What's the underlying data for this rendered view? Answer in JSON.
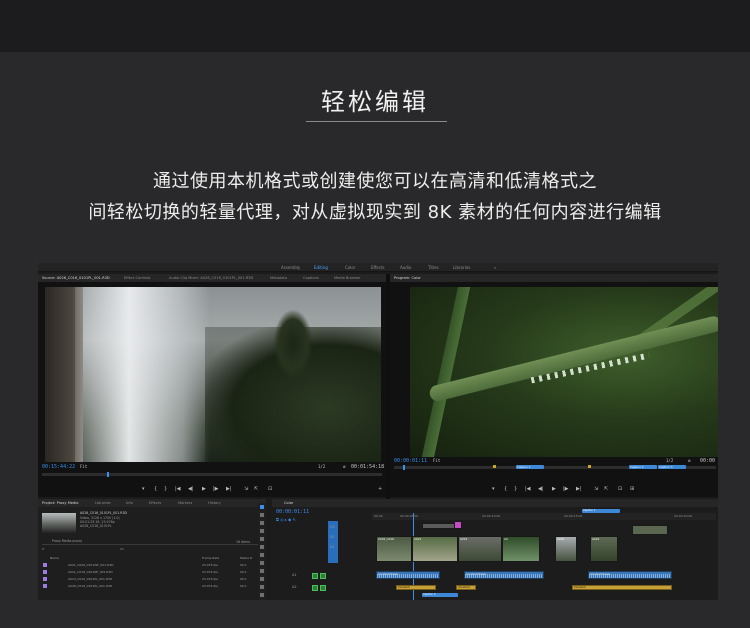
{
  "page": {
    "title": "轻松编辑",
    "desc_line1": "通过使用本机格式或创建使您可以在高清和低清格式之",
    "desc_line2": "间轻松切换的轻量代理，对从虚拟现实到 8K 素材的任何内容进行编辑"
  },
  "workspaces": [
    {
      "label": "Assembly",
      "active": false
    },
    {
      "label": "Editing",
      "active": true
    },
    {
      "label": "Color",
      "active": false
    },
    {
      "label": "Effects",
      "active": false
    },
    {
      "label": "Audio",
      "active": false
    },
    {
      "label": "Titles",
      "active": false
    },
    {
      "label": "Libraries",
      "active": false
    }
  ],
  "source_panel": {
    "tabs": [
      "Source: A026_C016_0101PL_001.R3D",
      "Effect Controls",
      "Audio Clip Mixer: A026_C016_0101PL_001.R3D",
      "Metadata",
      "Captions",
      "Media Browser"
    ],
    "timecode_in": "00:15:44:22",
    "fit": "Fit",
    "zoom": "1/2",
    "timecode_out": "00:01:54:18"
  },
  "program_panel": {
    "tab": "Program: Color",
    "timecode_in": "00:00:01:11",
    "fit": "Fit",
    "zoom": "1/2",
    "timecode_out": "00:00",
    "markers": [
      "Caption 1",
      "Caption 2",
      "Caption 3"
    ]
  },
  "transport": {
    "source_buttons": [
      "▾",
      "{",
      "}",
      "|◀",
      "◀|",
      "▶",
      "|▶",
      "▶|",
      "⇲",
      "⇱",
      "⊡",
      "+"
    ],
    "program_buttons": [
      "▾",
      "{",
      "}",
      "|◀",
      "◀|",
      "▶",
      "|▶",
      "▶|",
      "⇲",
      "⇱",
      "⊡",
      "⊞"
    ]
  },
  "project_panel": {
    "tabs": [
      "Project: Proxy Media",
      "Libraries",
      "Info",
      "Effects",
      "Markers",
      "History"
    ],
    "clip_name": "A026_C016_0101PL_001.R3D",
    "clip_info1": "Video, 3128 x 1700 (1.0)",
    "clip_info2": "00:01:33:16, 23.976p",
    "clip_info3": "A026_C016_0101PL",
    "project_file": "Proxy Media.prproj",
    "item_count": "16 Items",
    "columns": [
      "Name",
      "Frame Rate",
      "Media D"
    ],
    "rows": [
      {
        "name": "A021_C006_0101WF_001.R3D",
        "rate": "23.976 fps",
        "dur": "00:1"
      },
      {
        "name": "A021_C018_0101NF_001.R3D",
        "rate": "23.976 fps",
        "dur": "00:1"
      },
      {
        "name": "A024_C016_0101PL_001.R3D",
        "rate": "23.976 fps",
        "dur": "00:1"
      },
      {
        "name": "A026_C016_0101PL_001.R3D",
        "rate": "23.976 fps",
        "dur": "00:1"
      }
    ]
  },
  "timeline": {
    "tab": "Color",
    "timecode": "00:00:01:11",
    "ruler": [
      "00:00",
      "00:00:05:00",
      "00:00:10:00",
      "00:00:15:00",
      "00:00:20:00"
    ],
    "tracks": [
      "V3",
      "V2",
      "V1",
      "A1",
      "A2"
    ],
    "captions": [
      "Caption 1",
      "Caption 2"
    ],
    "video_clips": [
      "A026_C016",
      "A021",
      "A024",
      "A0",
      "A026",
      "A024"
    ],
    "audio_clips": [
      "Constant Power",
      "Constant Power",
      "Constant Power"
    ],
    "gold_clips": [
      "Constant",
      "Constant",
      "Constant"
    ]
  }
}
